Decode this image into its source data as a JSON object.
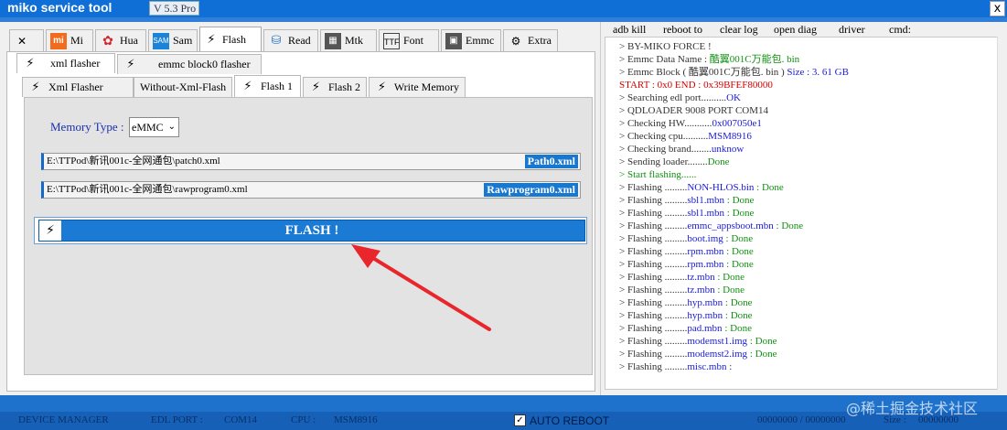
{
  "window": {
    "title": "miko service tool",
    "version": "V 5.3 Pro",
    "close_label": "x"
  },
  "main_tabs": [
    {
      "label": "",
      "icon": "tools-icon"
    },
    {
      "label": "Mi",
      "icon": "mi-logo-icon"
    },
    {
      "label": "Hua",
      "icon": "huawei-logo-icon"
    },
    {
      "label": "Sam",
      "icon": "samsung-logo-icon"
    },
    {
      "label": "Flash",
      "icon": "bolt-icon"
    },
    {
      "label": "Read",
      "icon": "database-icon"
    },
    {
      "label": "Mtk",
      "icon": "chip-icon"
    },
    {
      "label": "Font",
      "icon": "ttf-file-icon"
    },
    {
      "label": "Emmc",
      "icon": "emmc-chip-icon"
    },
    {
      "label": "Extra",
      "icon": "dtc-gear-icon"
    }
  ],
  "flash_tabs": [
    "xml flasher",
    "emmc block0 flasher"
  ],
  "xml_tabs": [
    "Xml Flasher",
    "Without-Xml-Flash",
    "Flash 1",
    "Flash 2",
    "Write Memory"
  ],
  "memory": {
    "label": "Memory Type :",
    "value": "eMMC"
  },
  "paths": [
    {
      "value": "E:\\TTPod\\新讯001c-全网通包\\patch0.xml",
      "button": "Path0.xml"
    },
    {
      "value": "E:\\TTPod\\新讯001c-全网通包\\rawprogram0.xml",
      "button": "Rawprogram0.xml"
    }
  ],
  "flash_button": "FLASH !",
  "right_menu": [
    "adb kill",
    "reboot to",
    "clear log",
    "open diag",
    "driver",
    "cmd:"
  ],
  "log": [
    [
      {
        "t": "> BY-MIKO FORCE !",
        "c": "k"
      }
    ],
    [
      {
        "t": "> Emmc Data Name : ",
        "c": "k"
      },
      {
        "t": "酷翼001C万能包. bin",
        "c": "g"
      }
    ],
    [
      {
        "t": "> Emmc Block ( 酷翼001C万能包. bin ) ",
        "c": "k"
      },
      {
        "t": "Size    :    3. 61 GB",
        "c": "b"
      }
    ],
    [
      {
        "t": " START  :  0x0    END  :  0x39BFEF80000",
        "c": "r"
      }
    ],
    [
      {
        "t": "> Searching edl port..........",
        "c": "k"
      },
      {
        "t": "OK",
        "c": "b"
      }
    ],
    [
      {
        "t": "> QDLOADER 9008 PORT COM14",
        "c": "k"
      }
    ],
    [
      {
        "t": "> Checking HW...........",
        "c": "k"
      },
      {
        "t": "0x007050e1",
        "c": "b"
      }
    ],
    [
      {
        "t": "> Checking cpu..........",
        "c": "k"
      },
      {
        "t": "MSM8916",
        "c": "b"
      }
    ],
    [
      {
        "t": "> Checking brand........",
        "c": "k"
      },
      {
        "t": "unknow",
        "c": "b"
      }
    ],
    [
      {
        "t": "> Sending loader........",
        "c": "k"
      },
      {
        "t": "Done",
        "c": "g"
      }
    ],
    [
      {
        "t": "> Start flashing......",
        "c": "g"
      }
    ],
    [
      {
        "t": "> Flashing .........",
        "c": "k"
      },
      {
        "t": "NON-HLOS.bin",
        "c": "b"
      },
      {
        "t": " :  Done",
        "c": "g"
      }
    ],
    [
      {
        "t": "> Flashing .........",
        "c": "k"
      },
      {
        "t": "sbl1.mbn",
        "c": "b"
      },
      {
        "t": " :  Done",
        "c": "g"
      }
    ],
    [
      {
        "t": "> Flashing .........",
        "c": "k"
      },
      {
        "t": "sbl1.mbn",
        "c": "b"
      },
      {
        "t": " :  Done",
        "c": "g"
      }
    ],
    [
      {
        "t": "> Flashing .........",
        "c": "k"
      },
      {
        "t": "emmc_appsboot.mbn",
        "c": "b"
      },
      {
        "t": " :  Done",
        "c": "g"
      }
    ],
    [
      {
        "t": "> Flashing .........",
        "c": "k"
      },
      {
        "t": "boot.img",
        "c": "b"
      },
      {
        "t": " :  Done",
        "c": "g"
      }
    ],
    [
      {
        "t": "> Flashing .........",
        "c": "k"
      },
      {
        "t": "rpm.mbn",
        "c": "b"
      },
      {
        "t": " :  Done",
        "c": "g"
      }
    ],
    [
      {
        "t": "> Flashing .........",
        "c": "k"
      },
      {
        "t": "rpm.mbn",
        "c": "b"
      },
      {
        "t": " :  Done",
        "c": "g"
      }
    ],
    [
      {
        "t": "> Flashing .........",
        "c": "k"
      },
      {
        "t": "tz.mbn",
        "c": "b"
      },
      {
        "t": " :  Done",
        "c": "g"
      }
    ],
    [
      {
        "t": "> Flashing .........",
        "c": "k"
      },
      {
        "t": "tz.mbn",
        "c": "b"
      },
      {
        "t": " :  Done",
        "c": "g"
      }
    ],
    [
      {
        "t": "> Flashing .........",
        "c": "k"
      },
      {
        "t": "hyp.mbn",
        "c": "b"
      },
      {
        "t": " :  Done",
        "c": "g"
      }
    ],
    [
      {
        "t": "> Flashing .........",
        "c": "k"
      },
      {
        "t": "hyp.mbn",
        "c": "b"
      },
      {
        "t": " :  Done",
        "c": "g"
      }
    ],
    [
      {
        "t": "> Flashing .........",
        "c": "k"
      },
      {
        "t": "pad.mbn",
        "c": "b"
      },
      {
        "t": " :  Done",
        "c": "g"
      }
    ],
    [
      {
        "t": "> Flashing .........",
        "c": "k"
      },
      {
        "t": "modemst1.img",
        "c": "b"
      },
      {
        "t": " :  Done",
        "c": "g"
      }
    ],
    [
      {
        "t": "> Flashing .........",
        "c": "k"
      },
      {
        "t": "modemst2.img",
        "c": "b"
      },
      {
        "t": " :  Done",
        "c": "g"
      }
    ],
    [
      {
        "t": "> Flashing .........",
        "c": "k"
      },
      {
        "t": "misc.mbn",
        "c": "b"
      },
      {
        "t": " :",
        "c": "k"
      }
    ]
  ],
  "status": {
    "device_manager": "DEVICE MANAGER",
    "edl_port_label": "EDL PORT :",
    "edl_port_value": "COM14",
    "cpu_label": "CPU :",
    "cpu_value": "MSM8916",
    "auto_reboot": "AUTO REBOOT",
    "auto_reboot_checked": true,
    "progress": "00000000 / 00000000",
    "size_label": "Size :",
    "size_value": "00000000"
  },
  "watermark": "@稀土掘金技术社区",
  "colors": {
    "title_bar": "#0f6fd6",
    "accent": "#1a7ad4",
    "status_bar": "#1660b8",
    "annotation_arrow": "#e8262c"
  }
}
